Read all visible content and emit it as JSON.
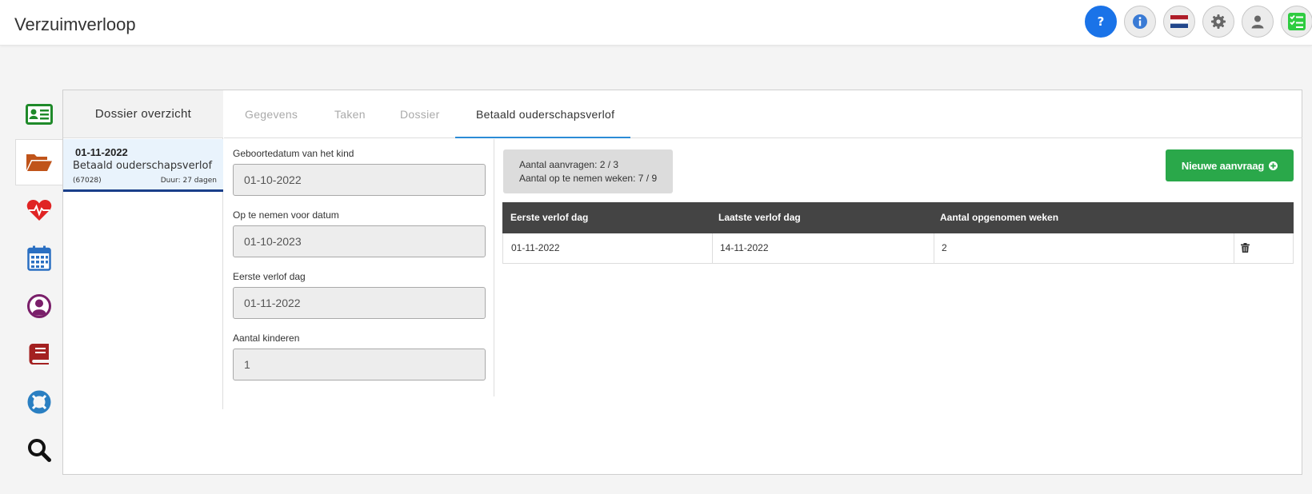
{
  "app": {
    "title": "Verzuimverloop"
  },
  "topbar": {
    "buttons": [
      {
        "name": "help",
        "icon": "question-icon",
        "color": "#1a73e8"
      },
      {
        "name": "info",
        "icon": "info-icon",
        "color": "#3a7bd5"
      },
      {
        "name": "language",
        "icon": "dutch-flag-icon"
      },
      {
        "name": "settings",
        "icon": "gear-icon"
      },
      {
        "name": "profile",
        "icon": "user-icon"
      },
      {
        "name": "tasks",
        "icon": "checklist-icon",
        "color": "#2ecc40"
      }
    ]
  },
  "rail": {
    "items": [
      {
        "icon": "id-card-icon",
        "color": "#1f8a2a"
      },
      {
        "icon": "folder-open-icon",
        "color": "#c0541a",
        "active": true
      },
      {
        "icon": "heartbeat-icon",
        "color": "#e02424"
      },
      {
        "icon": "calendar-icon",
        "color": "#2a6fc2"
      },
      {
        "icon": "user-circle-icon",
        "color": "#7a1f6a"
      },
      {
        "icon": "book-icon",
        "color": "#a32020"
      },
      {
        "icon": "lifebuoy-icon",
        "color": "#2a7fc2"
      },
      {
        "icon": "search-icon",
        "color": "#111111"
      }
    ]
  },
  "dossier": {
    "header": "Dossier overzicht",
    "item": {
      "date": "01-11-2022",
      "title": "Betaald ouderschapsverlof",
      "id": "(67028)",
      "duration": "Duur: 27 dagen"
    }
  },
  "tabs": [
    "Gegevens",
    "Taken",
    "Dossier",
    "Betaald ouderschapsverlof"
  ],
  "active_tab": "Betaald ouderschapsverlof",
  "form": {
    "fields": [
      {
        "label": "Geboortedatum van het kind",
        "value": "01-10-2022"
      },
      {
        "label": "Op te nemen voor datum",
        "value": "01-10-2023"
      },
      {
        "label": "Eerste verlof dag",
        "value": "01-11-2022"
      },
      {
        "label": "Aantal kinderen",
        "value": "1"
      }
    ]
  },
  "summary": {
    "requests_label": "Aantal aanvragen:",
    "requests_value": "2 / 3",
    "weeks_label": "Aantal op te nemen weken:",
    "weeks_value": "7 / 9"
  },
  "new_request_button": "Nieuwe aanvraag",
  "table": {
    "headers": [
      "Eerste verlof dag",
      "Laatste verlof dag",
      "Aantal opgenomen weken"
    ],
    "rows": [
      {
        "first_day": "01-11-2022",
        "last_day": "14-11-2022",
        "weeks": "2"
      }
    ]
  },
  "colors": {
    "accent": "#2b8cd6",
    "success": "#2aa84a",
    "table_header": "#444444"
  }
}
